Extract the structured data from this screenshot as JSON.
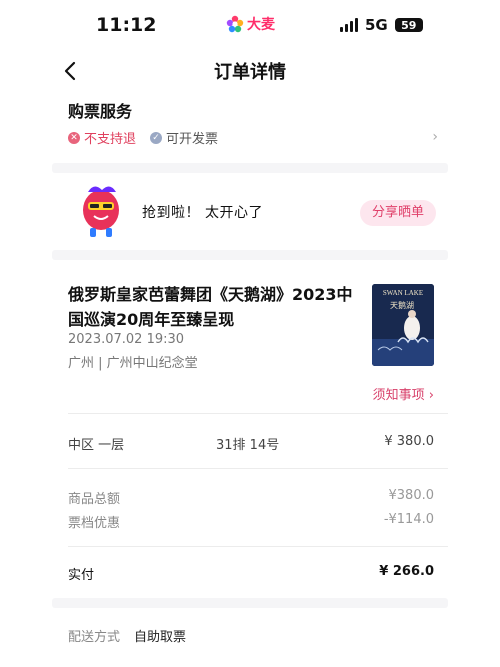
{
  "status_bar": {
    "time": "11:12",
    "app_logo_text": "大麦",
    "network": "5G",
    "battery": "59"
  },
  "nav": {
    "title": "订单详情",
    "back_icon": "chevron-left-icon"
  },
  "service": {
    "title": "购票服务",
    "items": [
      {
        "label": "不支持退",
        "icon": "x-circle-icon"
      },
      {
        "label": "可开发票",
        "icon": "check-circle-icon"
      }
    ]
  },
  "promo": {
    "text": "抢到啦！ 太开心了",
    "share_label": "分享晒单"
  },
  "show": {
    "title": "俄罗斯皇家芭蕾舞团《天鹅湖》2023中国巡演20周年至臻呈现",
    "datetime": "2023.07.02 19:30",
    "venue": "广州 | 广州中山纪念堂",
    "poster_text": "SWAN LAKE",
    "poster_subtext": "天鹅湖",
    "notice_label": "须知事项"
  },
  "ticket": {
    "zone": "中区 一层",
    "seat": "31排 14号",
    "price": "¥ 380.0"
  },
  "fees": [
    {
      "label": "商品总额",
      "value": "¥380.0"
    },
    {
      "label": "票档优惠",
      "value": "-¥114.0"
    }
  ],
  "paid": {
    "label": "实付",
    "value": "¥ 266.0"
  },
  "delivery": {
    "label": "配送方式",
    "value": "自助取票"
  },
  "colors": {
    "accent": "#e0406a",
    "brand": "#ff2d6a",
    "band": "#f5f5f7"
  }
}
